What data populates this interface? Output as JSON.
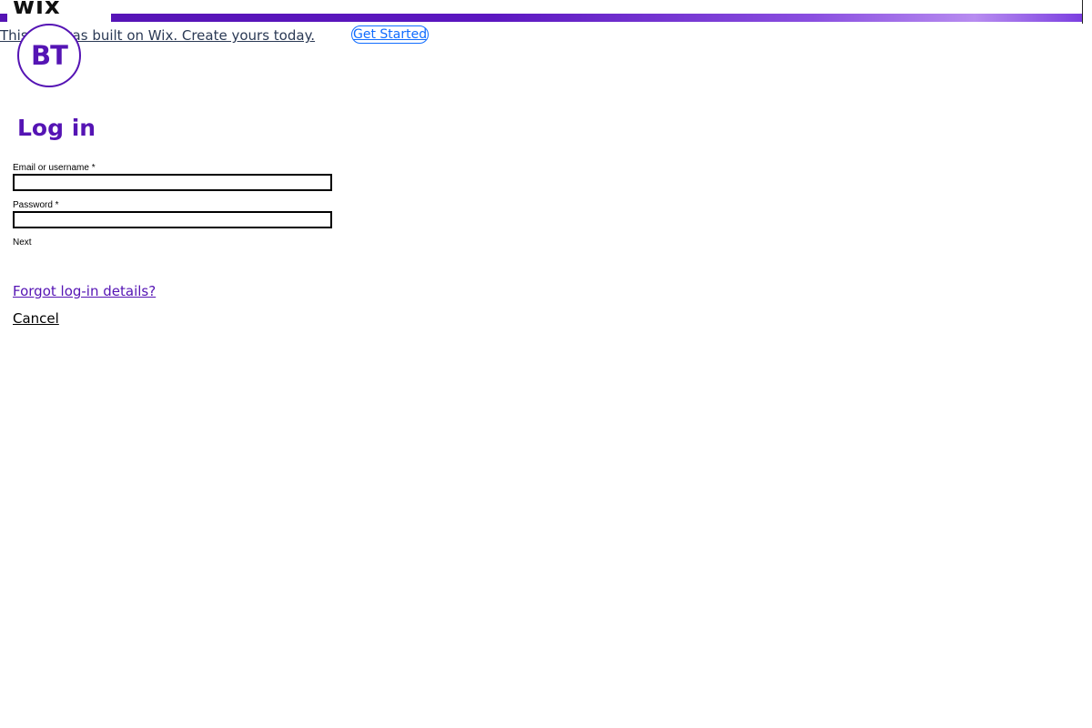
{
  "wix_banner": {
    "logo_text": "wix",
    "message": "This site was built on Wix. Create yours today.",
    "cta_label": "Get Started",
    "accent_color": "#5514b4",
    "cta_color": "#116dff"
  },
  "brand": {
    "logo_text": "BT",
    "color": "#5514b4"
  },
  "login_form": {
    "title": "Log in",
    "email_label": "Email or username *",
    "email_value": "",
    "password_label": "Password *",
    "password_value": "",
    "next_label": "Next",
    "forgot_label": "Forgot log-in details?",
    "cancel_label": "Cancel"
  }
}
